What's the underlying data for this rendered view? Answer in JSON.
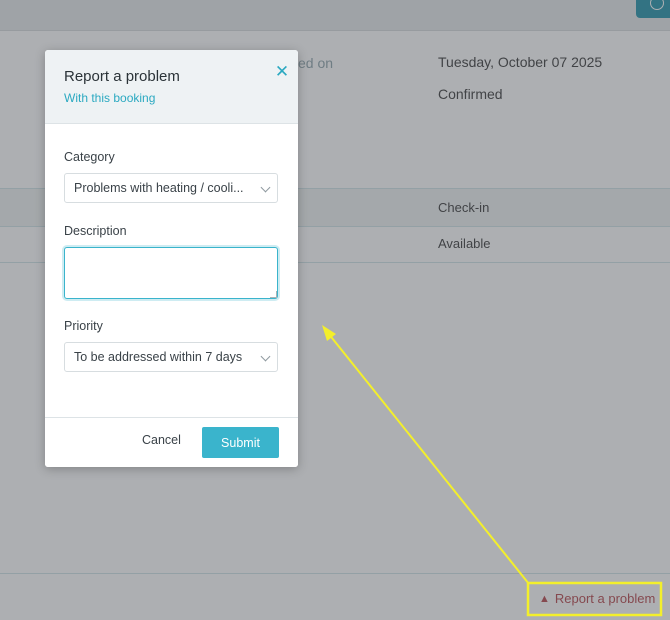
{
  "background": {
    "field_label_partial": "ed on",
    "booking_date": "Tuesday, October 07 2025",
    "booking_status": "Confirmed",
    "table": {
      "header_checkin": "Check-in",
      "row_availability": "Available"
    },
    "report_link": {
      "icon": "warning-icon",
      "icon_glyph": "▲",
      "label": "Report a problem"
    }
  },
  "modal": {
    "title": "Report a problem",
    "subtitle": "With this booking",
    "close_glyph": "✕",
    "category": {
      "label": "Category",
      "value": "Problems with heating / cooli..."
    },
    "description": {
      "label": "Description",
      "value": ""
    },
    "priority": {
      "label": "Priority",
      "value": "To be addressed within 7 days"
    },
    "cancel_label": "Cancel",
    "submit_label": "Submit"
  },
  "colors": {
    "accent": "#3ab4cc",
    "danger": "#b43f45",
    "annotation": "#f3ef2b"
  }
}
